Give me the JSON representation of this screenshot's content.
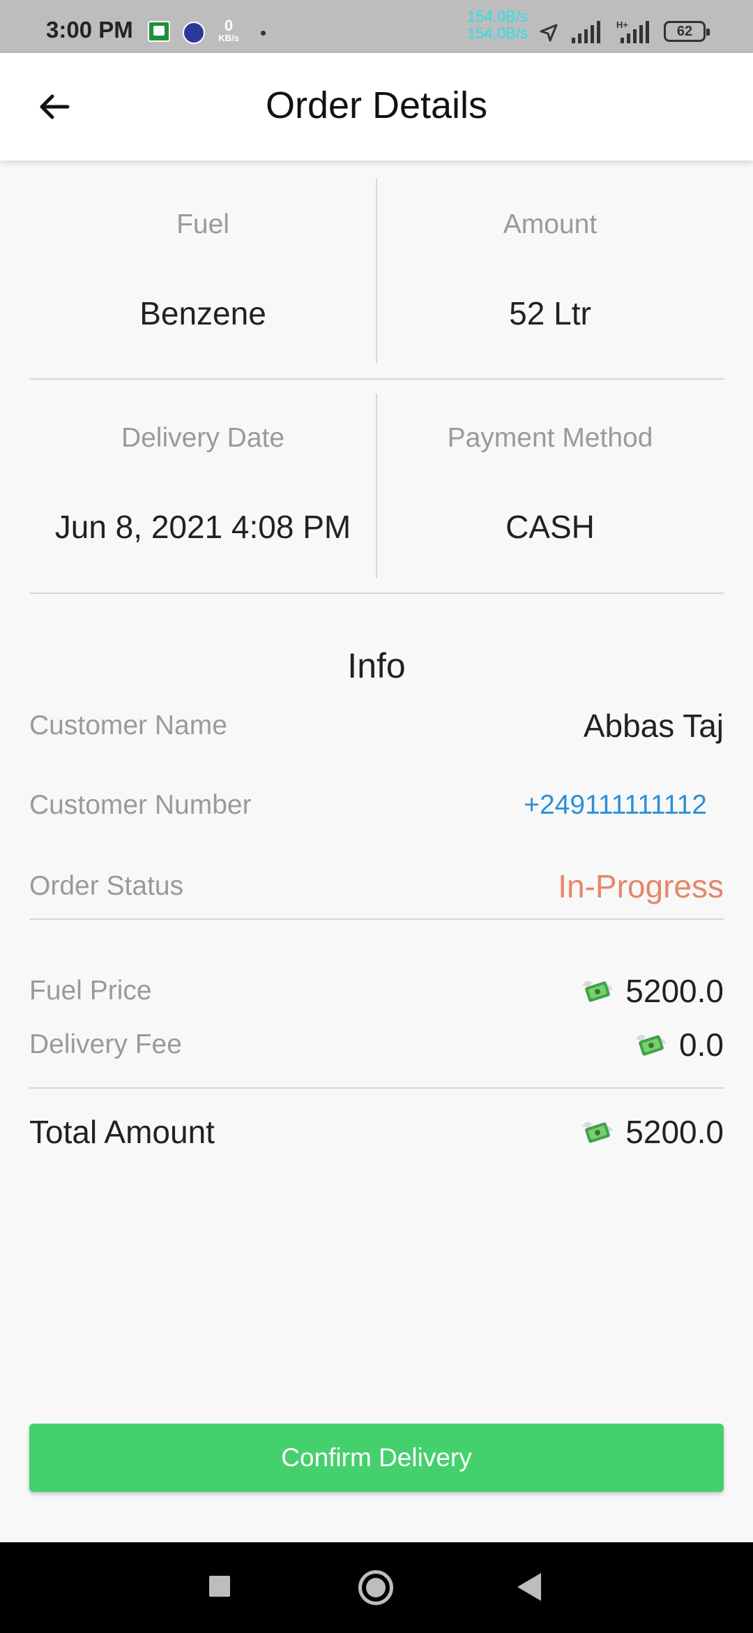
{
  "status_bar": {
    "time": "3:00 PM",
    "kb_value": "0",
    "kb_unit": "KB/s",
    "speed_up": "154.0B/s",
    "speed_down": "154.0B/s",
    "network_type": "H+",
    "battery": "62"
  },
  "header": {
    "title": "Order Details",
    "back_icon": "arrow-left-icon"
  },
  "details": {
    "fuel_label": "Fuel",
    "fuel_value": "Benzene",
    "amount_label": "Amount",
    "amount_value": "52 Ltr",
    "delivery_date_label": "Delivery Date",
    "delivery_date_value": "Jun 8, 2021 4:08 PM",
    "payment_method_label": "Payment Method",
    "payment_method_value": "CASH"
  },
  "info": {
    "title": "Info",
    "customer_name_label": "Customer Name",
    "customer_name_value": "Abbas Taj",
    "customer_number_label": "Customer Number",
    "customer_number_value": "+249111111112",
    "order_status_label": "Order Status",
    "order_status_value": "In-Progress"
  },
  "pricing": {
    "fuel_price_label": "Fuel Price",
    "fuel_price_value": "5200.0",
    "delivery_fee_label": "Delivery Fee",
    "delivery_fee_value": "0.0",
    "total_label": "Total Amount",
    "total_value": "5200.0",
    "currency_icon": "money-with-wings-icon"
  },
  "actions": {
    "confirm_label": "Confirm Delivery"
  },
  "colors": {
    "accent_green": "#45d06e",
    "phone_blue": "#2a90d8",
    "status_orange": "#e6866a"
  }
}
